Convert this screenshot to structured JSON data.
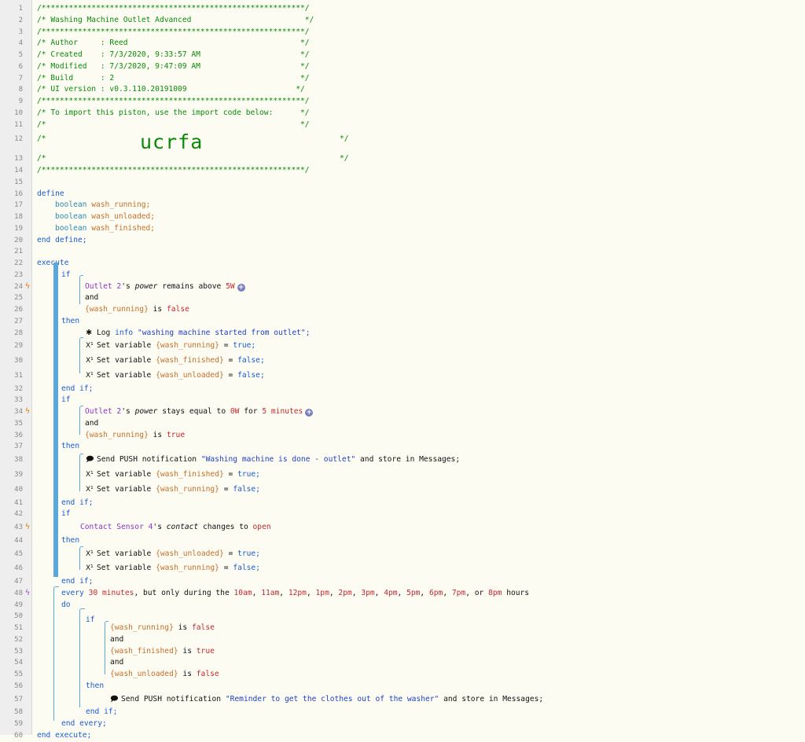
{
  "header": {
    "stars": "/**********************************************************/",
    "title": "/* Washing Machine Outlet Advanced                         */",
    "author": "/* Author     : Reed                                      */",
    "created": "/* Created    : 7/3/2020, 9:33:57 AM                      */",
    "modified": "/* Modified   : 7/3/2020, 9:47:09 AM                      */",
    "build": "/* Build      : 2                                         */",
    "ui_version": "/* UI version : v0.3.110.20191009                        */",
    "import_text": "/* To import this piston, use the import code below:      */",
    "blank": "/*                                                        */",
    "code_prefix": "/*",
    "code_suffix": "*/",
    "import_code": "ucrfa"
  },
  "define": {
    "open": "define",
    "close": "end define;",
    "type": "boolean",
    "vars": [
      "wash_running;",
      "wash_unloaded;",
      "wash_finished;"
    ]
  },
  "kw": {
    "execute": "execute",
    "end_execute": "end execute;",
    "if": "if",
    "then": "then",
    "do": "do",
    "and": "and",
    "end_if": "end if;",
    "end_every": "end every;",
    "is": "is",
    "false": "false",
    "true": "true",
    "false_semi": "false;",
    "true_semi": "true;",
    "eq": "=",
    "set_variable": "Set variable",
    "send_push": "Send PUSH notification",
    "store_in": "and store in Messages;",
    "log_info": "Log",
    "info": "info"
  },
  "vars": {
    "wash_running": "{wash_running}",
    "wash_finished": "{wash_finished}",
    "wash_unloaded": "{wash_unloaded}"
  },
  "block1": {
    "device": "Outlet 2",
    "poss": "'s",
    "attr": "power",
    "op": "remains above",
    "value": "5W",
    "log_msg": "\"washing machine started from outlet\";"
  },
  "block2": {
    "device": "Outlet 2",
    "poss": "'s",
    "attr": "power",
    "op": "stays equal to",
    "value": "0W",
    "for": "for",
    "duration": "5 minutes",
    "push_msg": "\"Washing machine is done - outlet\""
  },
  "block3": {
    "device": "Contact Sensor 4",
    "poss": "'s",
    "attr": "contact",
    "op": "changes to",
    "value": "open"
  },
  "block4": {
    "every": "every",
    "interval": "30 minutes",
    "mid": ", but only during the",
    "hours": [
      "10am",
      "11am",
      "12pm",
      "1pm",
      "2pm",
      "3pm",
      "4pm",
      "5pm",
      "6pm",
      "7pm",
      "8pm"
    ],
    "sep": ", ",
    "or": ", or ",
    "tail": "hours",
    "push_msg": "\"Reminder to get the clothes out of the washer\""
  },
  "icons": {
    "trigger": "trigger-bolt-icon",
    "timer": "timer-trigger-icon",
    "log": "bug-log-icon",
    "variable": "set-variable-icon",
    "notification": "speech-bubble-icon",
    "add": "add-condition-icon"
  },
  "colors": {
    "background": "#fdfcf3",
    "gutter": "#eeeeee",
    "comment": "#0a8a0a",
    "keyword": "#1a5bd0",
    "variable": "#c46f2a",
    "device": "#8a35c8",
    "string": "#1f3fc0",
    "number": "#c0292f",
    "bracket": "#5aa7d8"
  }
}
